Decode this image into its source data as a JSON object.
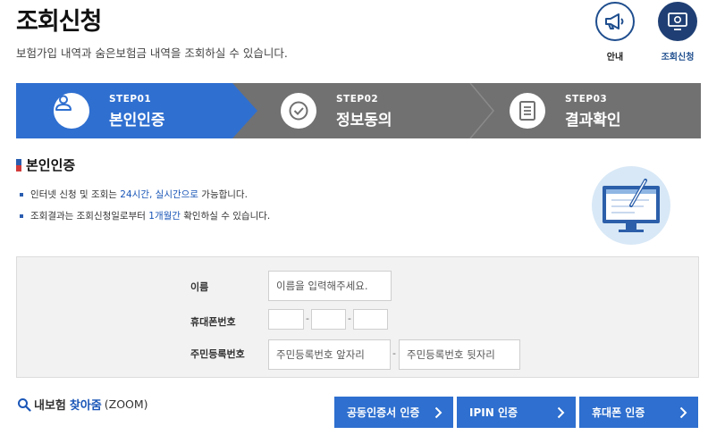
{
  "header": {
    "title": "조회신청",
    "description": "보험가입 내역과 숨은보험금 내역을 조회하실 수 있습니다."
  },
  "top_buttons": {
    "info_label": "안내",
    "apply_label": "조회신청"
  },
  "steps": [
    {
      "no": "STEP01",
      "name": "본인인증",
      "icon": "person-icon",
      "active": true
    },
    {
      "no": "STEP02",
      "name": "정보동의",
      "icon": "check-circle-icon",
      "active": false
    },
    {
      "no": "STEP03",
      "name": "결과확인",
      "icon": "document-icon",
      "active": false
    }
  ],
  "section": {
    "title": "본인인증",
    "notes": [
      {
        "pre": "인터넷 신청 및 조회는 ",
        "hl": "24시간, 실시간으로",
        "post": " 가능합니다."
      },
      {
        "pre": "조회결과는 조회신청일로부터 ",
        "hl": "1개월간",
        "post": " 확인하실 수 있습니다."
      }
    ]
  },
  "form": {
    "name_label": "이름",
    "name_placeholder": "이름을 입력해주세요.",
    "phone_label": "휴대폰번호",
    "phone_sep": "-",
    "rrn_label": "주민등록번호",
    "rrn_front_placeholder": "주민등록번호 앞자리",
    "rrn_back_placeholder": "주민등록번호 뒷자리",
    "rrn_sep": "-"
  },
  "zoom": {
    "part1": "내보험",
    "part2": "찾아줌",
    "part3": "(ZOOM)"
  },
  "auth_buttons": [
    {
      "label": "공동인증서 인증"
    },
    {
      "label": "IPIN 인증"
    },
    {
      "label": "휴대폰 인증"
    }
  ],
  "colors": {
    "active_step": "#2f6fd0",
    "inactive_step": "#717171",
    "button_blue": "#2e6fcf",
    "highlight": "#1a56b7",
    "navy": "#1f3f74"
  }
}
